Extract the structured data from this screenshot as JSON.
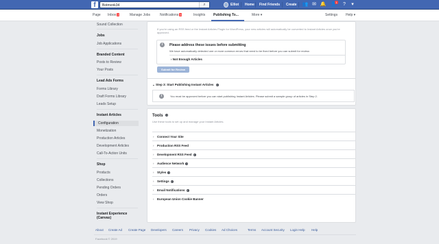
{
  "topbar": {
    "logo": "f",
    "search_value": "Botmonk34",
    "user_name": "Elliot",
    "links": [
      "Home",
      "Find Friends",
      "Create"
    ],
    "friend_badge": "1"
  },
  "page_tabs": {
    "page": "Page",
    "inbox": "Inbox",
    "inbox_badge": "2",
    "manage_jobs": "Manage Jobs",
    "notifications": "Notifications",
    "notifications_badge": "9",
    "insights": "Insights",
    "publishing": "Publishing To...",
    "more": "More ▾",
    "settings": "Settings",
    "help": "Help ▾"
  },
  "sidebar": {
    "sound_collection": "Sound Collection",
    "jobs_header": "Jobs",
    "job_applications": "Job Applications",
    "branded_header": "Branded Content",
    "posts_to_review": "Posts to Review",
    "your_posts": "Your Posts",
    "lead_ads_header": "Lead Ads Forms",
    "forms_library": "Forms Library",
    "draft_forms_library": "Draft Forms Library",
    "leads_setup": "Leads Setup",
    "instant_articles_header": "Instant Articles",
    "configuration": "Configuration",
    "monetization": "Monetization",
    "production_articles": "Production Articles",
    "development_articles": "Development Articles",
    "call_to_action_units": "Call-To-Action Units",
    "shop_header": "Shop",
    "products": "Products",
    "collections": "Collections",
    "pending_orders": "Pending Orders",
    "orders": "Orders",
    "view_shop": "View Shop",
    "instant_experience_header": "Instant Experience (Canvas)"
  },
  "submit_section": {
    "note": "If you're using an RSS feed or the Instant Articles Plugin for WordPress, your new articles will automatically be converted to Instant Articles once you're approved.",
    "warning_title": "Please address these issues before submitting",
    "warning_text": "We have automatically detected one or more common errors that need to be fixed before you can submit for review.",
    "not_enough_articles": "Not Enough Articles",
    "submit_button": "Submit for Review",
    "step3_title": "Step 3: Start Publishing Instant Articles",
    "step3_text": "You must be approved before you can start publishing Instant Articles. Please submit a sample group of articles in Step 2."
  },
  "tools": {
    "title": "Tools",
    "subtitle": "Use these tools to set up and manage your Instant Articles.",
    "rows": [
      "Connect Your Site",
      "Production RSS Feed",
      "Development RSS Feed",
      "Audience Network",
      "Styles",
      "Settings",
      "Email Notifications",
      "European Union Cookie Banner"
    ]
  },
  "footer": {
    "links": [
      "About",
      "Create Ad",
      "Create Page",
      "Developers",
      "Careers",
      "Privacy",
      "Cookies",
      "Ad Choices",
      "Terms",
      "Account Security",
      "Login Help",
      "Help"
    ],
    "copyright": "Facebook © 2019"
  }
}
